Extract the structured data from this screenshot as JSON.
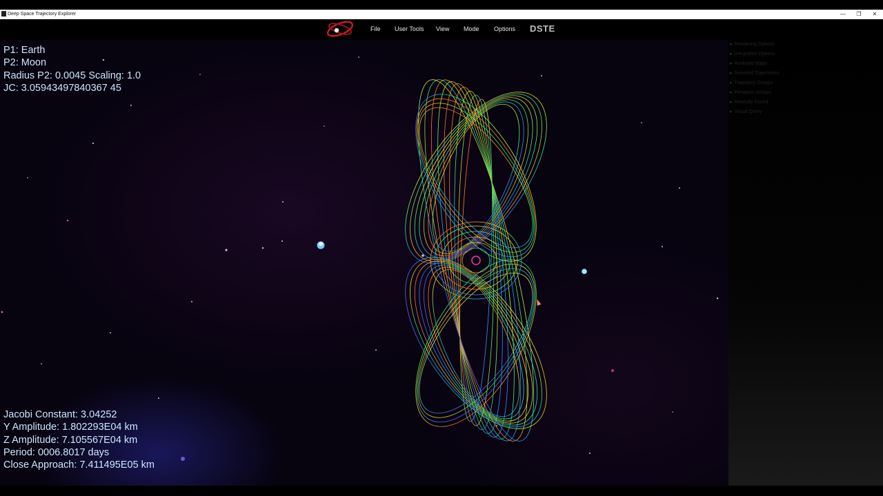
{
  "window": {
    "title": "Deep Space Trajectory Explorer",
    "controls": [
      "—",
      "❐",
      "✕"
    ]
  },
  "menu": {
    "items": [
      "File",
      "User Tools",
      "View",
      "Mode",
      "Options"
    ],
    "brand": "DSTE"
  },
  "side_panel": {
    "items": [
      "Rendering Options",
      "Integration Options",
      "Available Maps",
      "Selected Trajectories",
      "Trajectory Groups",
      "Periapsis Groups",
      "Recently Found",
      "Visual Query"
    ]
  },
  "hud_top": {
    "p1": "P1: Earth",
    "p2": "P2: Moon",
    "radius": "Radius P2: 0.0045 Scaling: 1.0",
    "jc": "JC: 3.05943497840367 45"
  },
  "hud_bottom": {
    "jacobi": "Jacobi Constant: 3.04252",
    "y_amp": "Y Amplitude: 1.802293E04 km",
    "z_amp": "Z Amplitude: 7.105567E04 km",
    "period": "Period: 0006.8017 days",
    "approach": "Close Approach: 7.411495E05 km"
  },
  "icons": [
    "app-icon",
    "dste-logo",
    "expand-arrow-icon",
    "mouse-cursor-icon"
  ],
  "colors": {
    "hud_text": "#cde7ff",
    "background": "#07030f",
    "logo_red": "#d0202a"
  }
}
